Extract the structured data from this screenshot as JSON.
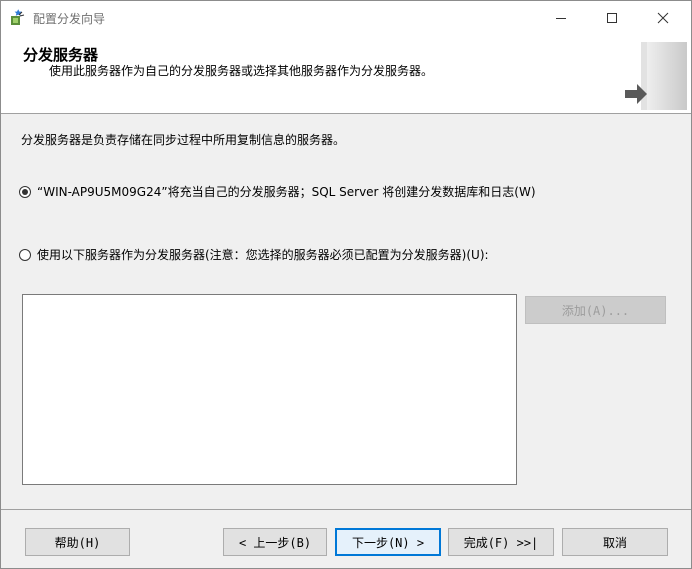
{
  "window": {
    "title": "配置分发向导"
  },
  "titlebar": {
    "app_icon": "wizard-app-icon",
    "min_icon": "minimize-icon",
    "max_icon": "maximize-icon",
    "close_icon": "close-icon"
  },
  "header": {
    "title": "分发服务器",
    "subtitle": "使用此服务器作为自己的分发服务器或选择其他服务器作为分发服务器。",
    "graphic": "server-arrow-graphic"
  },
  "content": {
    "description": "分发服务器是负责存储在同步过程中所用复制信息的服务器。",
    "options": [
      {
        "label": "“WIN-AP9U5M09G24”将充当自己的分发服务器；SQL Server 将创建分发数据库和日志(W)",
        "checked": true
      },
      {
        "label": "使用以下服务器作为分发服务器(注意：您选择的服务器必须已配置为分发服务器)(U):",
        "checked": false
      }
    ],
    "server_list": [],
    "add_button": "添加(A)..."
  },
  "footer": {
    "help": "帮助(H)",
    "prev": "< 上一步(B)",
    "next": "下一步(N) >",
    "finish": "完成(F) >>|",
    "cancel": "取消"
  },
  "colors": {
    "focus": "#0078d7",
    "disabled_text": "#9d9d9d",
    "window_bg": "#f0f0f0"
  }
}
